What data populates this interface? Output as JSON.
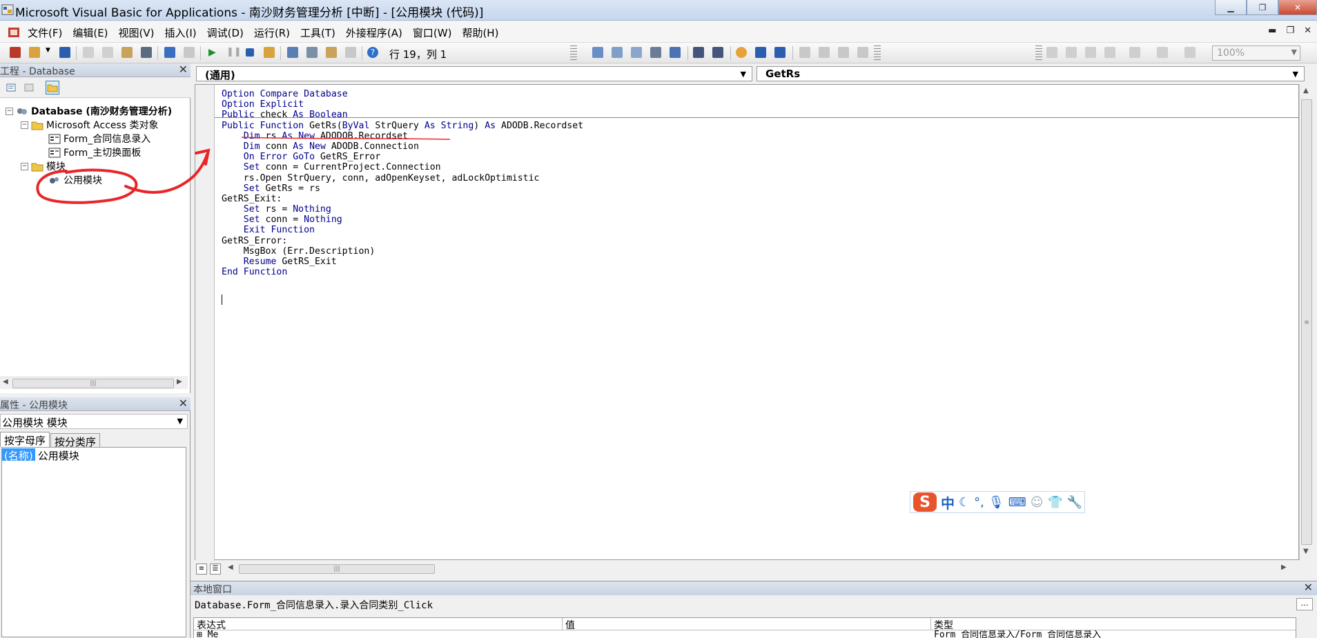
{
  "window": {
    "title": "Microsoft Visual Basic for Applications - 南沙财务管理分析 [中断] - [公用模块 (代码)]"
  },
  "menu": {
    "items": [
      "文件(F)",
      "编辑(E)",
      "视图(V)",
      "插入(I)",
      "调试(D)",
      "运行(R)",
      "工具(T)",
      "外接程序(A)",
      "窗口(W)",
      "帮助(H)"
    ]
  },
  "toolbar": {
    "position_text": "行 19，列 1",
    "zoom": "100%"
  },
  "project_pane": {
    "title": "工程 - Database",
    "tree": {
      "root": "Database (南沙财务管理分析)",
      "access_group": "Microsoft Access 类对象",
      "form1": "Form_合同信息录入",
      "form2": "Form_主切换面板",
      "modules_group": "模块",
      "module1": "公用模块"
    }
  },
  "properties_pane": {
    "title": "属性 - 公用模块",
    "selected_object": "公用模块 模块",
    "tabs": [
      "按字母序",
      "按分类序"
    ],
    "row_key": "(名称)",
    "row_value": "公用模块"
  },
  "code_window": {
    "object_combo": "(通用)",
    "proc_combo": "GetRs",
    "lines": [
      "Option Compare Database",
      "Option Explicit",
      "Public check As Boolean",
      "Public Function GetRs(ByVal StrQuery As String) As ADODB.Recordset",
      "    Dim rs As New ADODOB.Recordset",
      "    Dim conn As New ADODB.Connection",
      "    On Error GoTo GetRS_Error",
      "    Set conn = CurrentProject.Connection",
      "    rs.Open StrQuery, conn, adOpenKeyset, adLockOptimistic",
      "    Set GetRs = rs",
      "GetRS_Exit:",
      "    Set rs = Nothing",
      "    Set conn = Nothing",
      "    Exit Function",
      "GetRS_Error:",
      "    MsgBox (Err.Description)",
      "    Resume GetRS_Exit",
      "End Function"
    ]
  },
  "ime": {
    "logo": "S",
    "mode": "中"
  },
  "locals": {
    "title": "本地窗口",
    "context": "Database.Form_合同信息录入.录入合同类别_Click",
    "headers": [
      "表达式",
      "值",
      "类型"
    ],
    "row_expr": "⊞ Me",
    "row_value": "",
    "row_type": "Form_合同信息录入/Form_合同信息录入"
  },
  "colors": {
    "annotation": "#e8262a",
    "keyword": "#00008b",
    "selection": "#3399ff"
  }
}
